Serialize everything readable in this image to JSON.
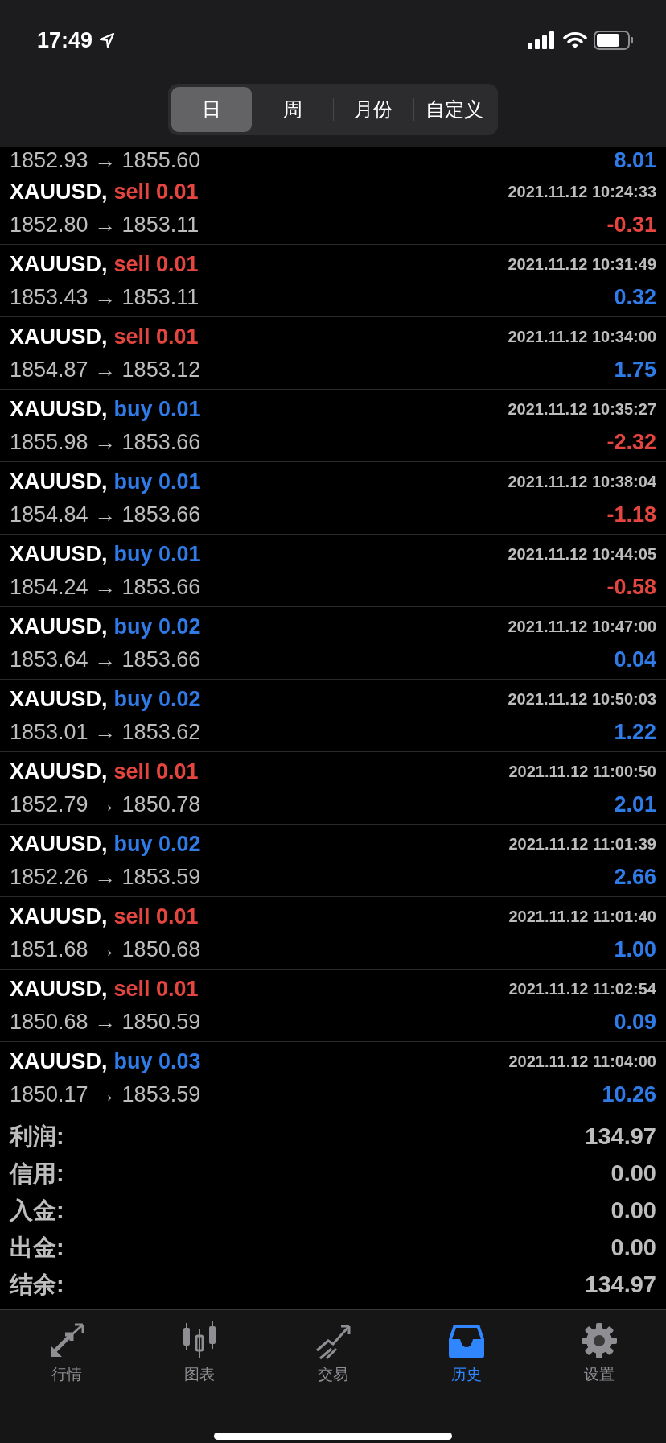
{
  "status_bar": {
    "time": "17:49"
  },
  "segments": [
    {
      "label": "日",
      "selected": true
    },
    {
      "label": "周",
      "selected": false
    },
    {
      "label": "月份",
      "selected": false
    },
    {
      "label": "自定义",
      "selected": false
    }
  ],
  "partial_row": {
    "prices": "1852.93 → 1855.60",
    "profit": "8.01",
    "negative": false
  },
  "trades": [
    {
      "symbol": "XAUUSD,",
      "order": "sell 0.01",
      "kind": "sell",
      "time": "2021.11.12 10:24:33",
      "prices": "1852.80 → 1853.11",
      "profit": "-0.31",
      "negative": true
    },
    {
      "symbol": "XAUUSD,",
      "order": "sell 0.01",
      "kind": "sell",
      "time": "2021.11.12 10:31:49",
      "prices": "1853.43 → 1853.11",
      "profit": "0.32",
      "negative": false
    },
    {
      "symbol": "XAUUSD,",
      "order": "sell 0.01",
      "kind": "sell",
      "time": "2021.11.12 10:34:00",
      "prices": "1854.87 → 1853.12",
      "profit": "1.75",
      "negative": false
    },
    {
      "symbol": "XAUUSD,",
      "order": "buy 0.01",
      "kind": "buy",
      "time": "2021.11.12 10:35:27",
      "prices": "1855.98 → 1853.66",
      "profit": "-2.32",
      "negative": true
    },
    {
      "symbol": "XAUUSD,",
      "order": "buy 0.01",
      "kind": "buy",
      "time": "2021.11.12 10:38:04",
      "prices": "1854.84 → 1853.66",
      "profit": "-1.18",
      "negative": true
    },
    {
      "symbol": "XAUUSD,",
      "order": "buy 0.01",
      "kind": "buy",
      "time": "2021.11.12 10:44:05",
      "prices": "1854.24 → 1853.66",
      "profit": "-0.58",
      "negative": true
    },
    {
      "symbol": "XAUUSD,",
      "order": "buy 0.02",
      "kind": "buy",
      "time": "2021.11.12 10:47:00",
      "prices": "1853.64 → 1853.66",
      "profit": "0.04",
      "negative": false
    },
    {
      "symbol": "XAUUSD,",
      "order": "buy 0.02",
      "kind": "buy",
      "time": "2021.11.12 10:50:03",
      "prices": "1853.01 → 1853.62",
      "profit": "1.22",
      "negative": false
    },
    {
      "symbol": "XAUUSD,",
      "order": "sell 0.01",
      "kind": "sell",
      "time": "2021.11.12 11:00:50",
      "prices": "1852.79 → 1850.78",
      "profit": "2.01",
      "negative": false
    },
    {
      "symbol": "XAUUSD,",
      "order": "buy 0.02",
      "kind": "buy",
      "time": "2021.11.12 11:01:39",
      "prices": "1852.26 → 1853.59",
      "profit": "2.66",
      "negative": false
    },
    {
      "symbol": "XAUUSD,",
      "order": "sell 0.01",
      "kind": "sell",
      "time": "2021.11.12 11:01:40",
      "prices": "1851.68 → 1850.68",
      "profit": "1.00",
      "negative": false
    },
    {
      "symbol": "XAUUSD,",
      "order": "sell 0.01",
      "kind": "sell",
      "time": "2021.11.12 11:02:54",
      "prices": "1850.68 → 1850.59",
      "profit": "0.09",
      "negative": false
    },
    {
      "symbol": "XAUUSD,",
      "order": "buy 0.03",
      "kind": "buy",
      "time": "2021.11.12 11:04:00",
      "prices": "1850.17 → 1853.59",
      "profit": "10.26",
      "negative": false
    }
  ],
  "summary": [
    {
      "label": "利润:",
      "value": "134.97"
    },
    {
      "label": "信用:",
      "value": "0.00"
    },
    {
      "label": "入金:",
      "value": "0.00"
    },
    {
      "label": "出金:",
      "value": "0.00"
    },
    {
      "label": "结余:",
      "value": "134.97"
    }
  ],
  "tab_bar": [
    {
      "label": "行情",
      "selected": false
    },
    {
      "label": "图表",
      "selected": false
    },
    {
      "label": "交易",
      "selected": false
    },
    {
      "label": "历史",
      "selected": true
    },
    {
      "label": "设置",
      "selected": false
    }
  ]
}
